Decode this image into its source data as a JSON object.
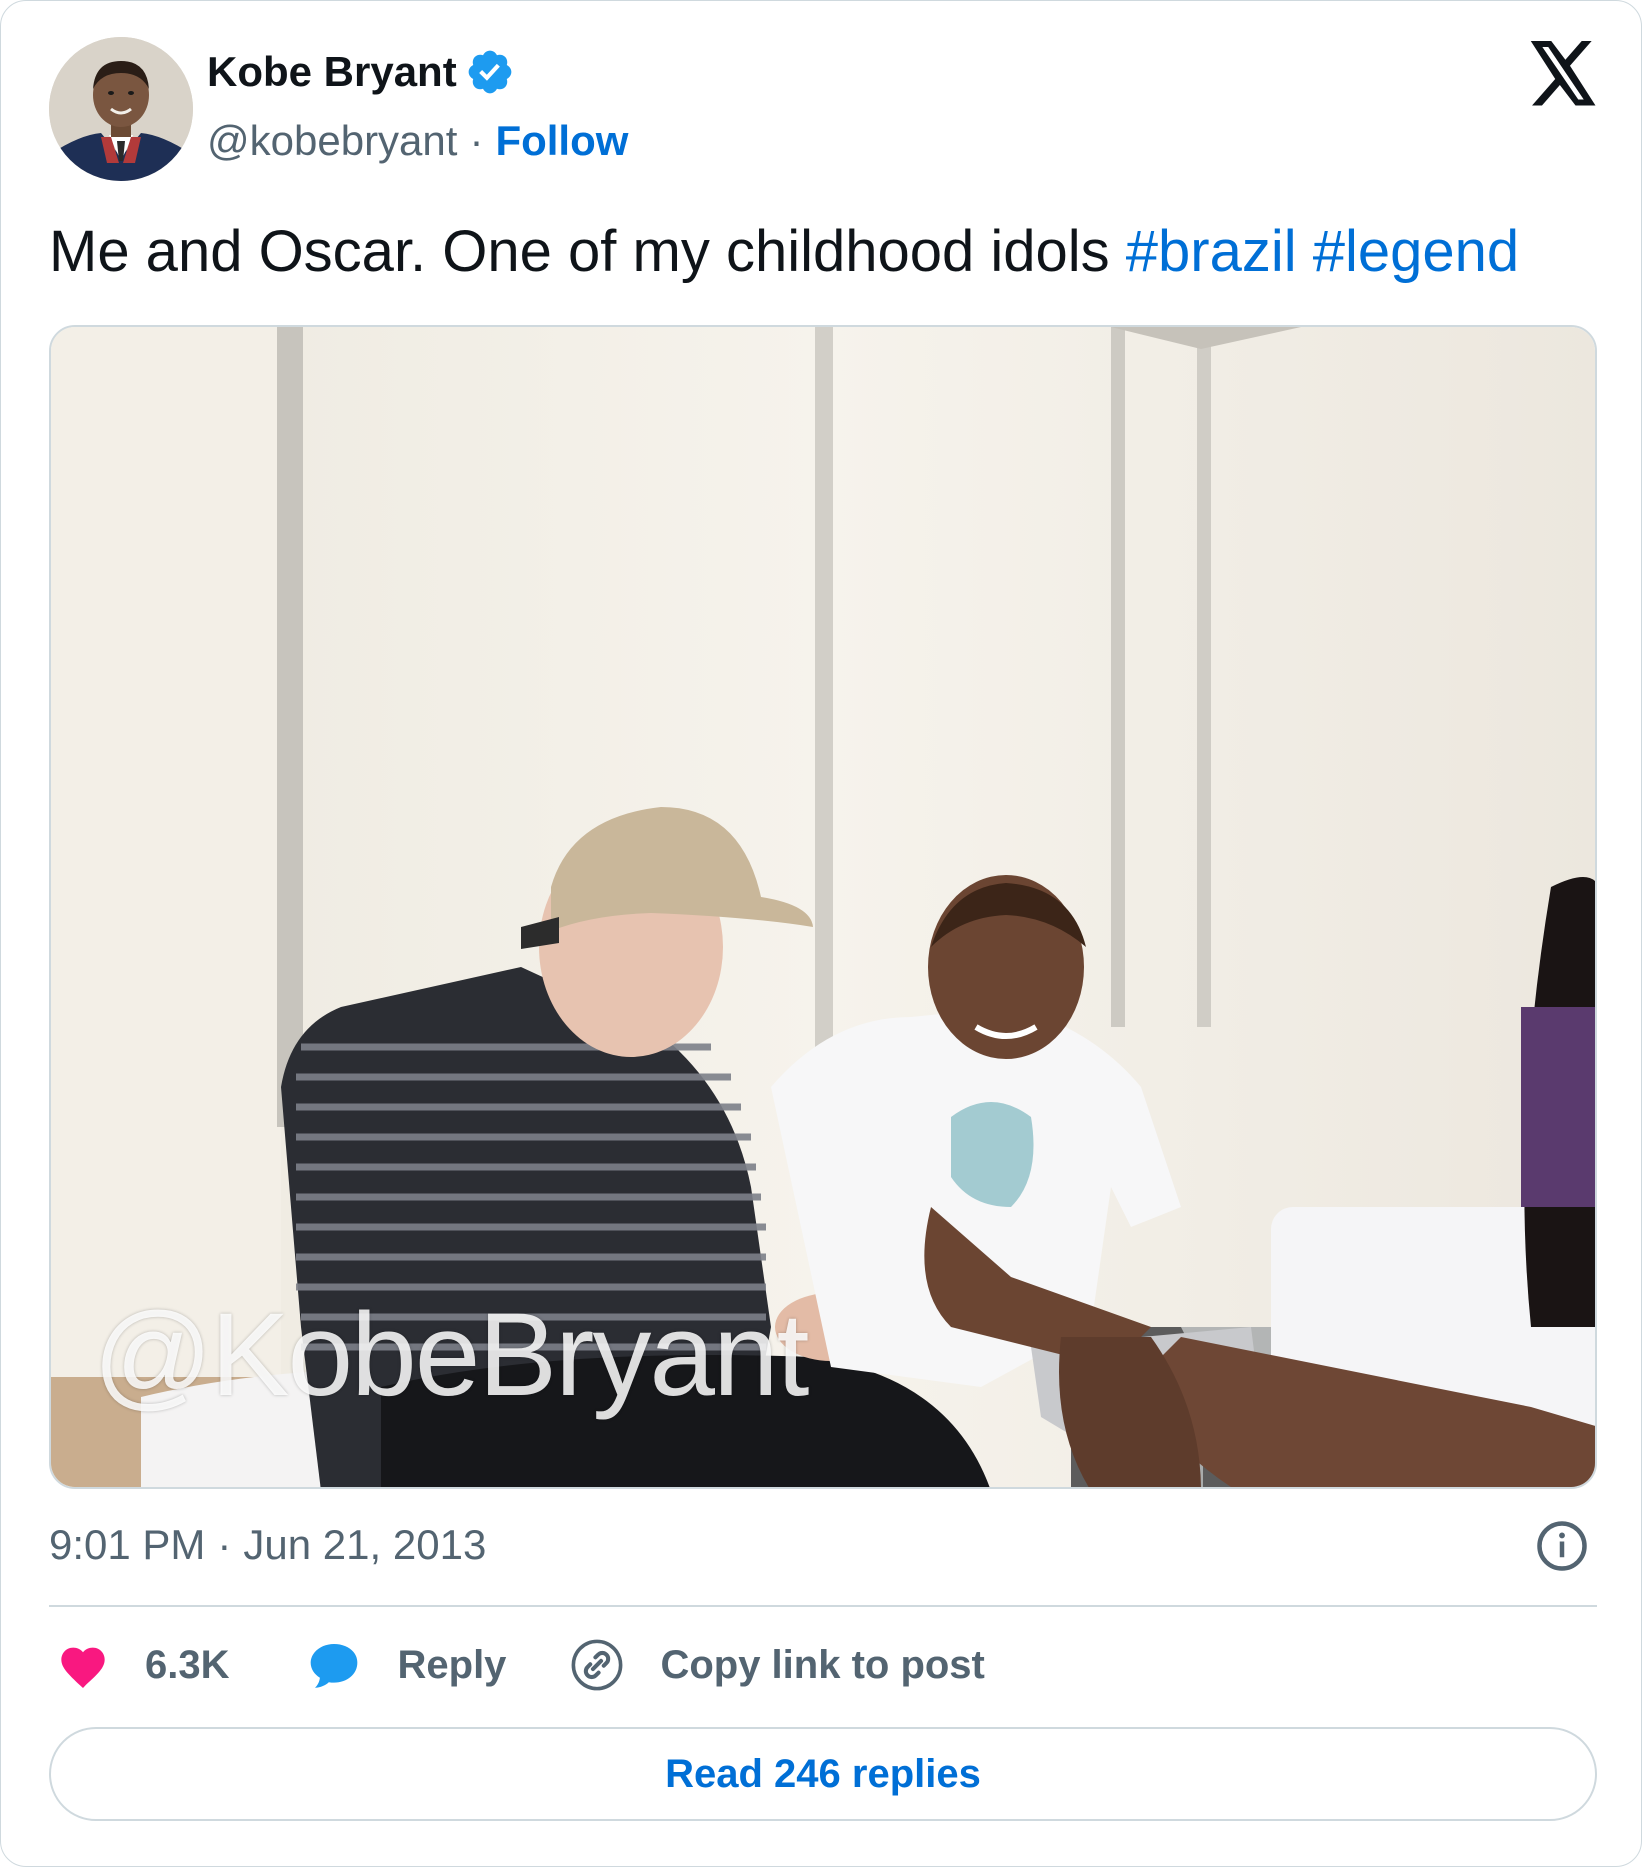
{
  "author": {
    "name": "Kobe Bryant",
    "handle": "@kobebryant",
    "separator": "·",
    "follow_label": "Follow"
  },
  "tweet": {
    "text": "Me and Oscar. One of my childhood idols",
    "hashtags": [
      "#brazil",
      "#legend"
    ]
  },
  "media": {
    "watermark": "@KobeBryant"
  },
  "meta": {
    "time": "9:01 PM",
    "separator": "·",
    "date": "Jun 21, 2013"
  },
  "actions": {
    "like_count": "6.3K",
    "reply_label": "Reply",
    "copy_label": "Copy link to post"
  },
  "read_replies_label": "Read 246 replies",
  "colors": {
    "link": "#006fd6",
    "like": "#f91880",
    "reply_icon": "#1d9bf0",
    "text": "#0f1419",
    "muted": "#536471",
    "border": "#cfd9de"
  },
  "icons": [
    "verified-badge-icon",
    "x-logo-icon",
    "info-icon",
    "heart-icon",
    "reply-bubble-icon",
    "link-icon"
  ]
}
